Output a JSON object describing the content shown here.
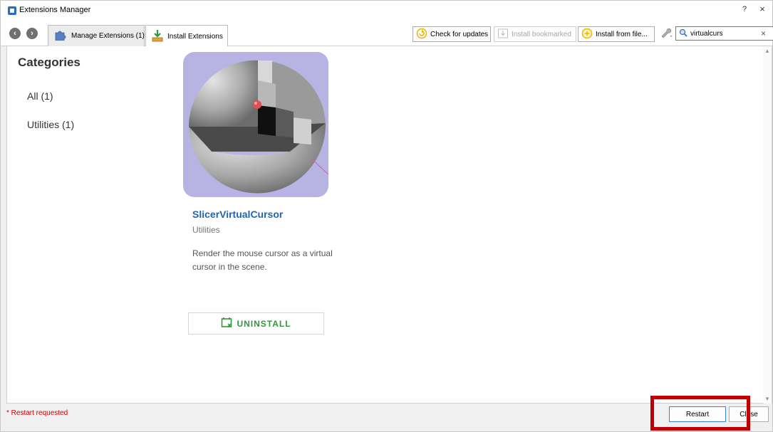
{
  "window": {
    "title": "Extensions Manager",
    "help": "?",
    "close": "×"
  },
  "toolbar": {
    "back_icon": "arrow-left-icon",
    "forward_icon": "arrow-right-icon",
    "tabs": [
      {
        "label": "Manage Extensions (1)",
        "icon": "puzzle-icon",
        "active": false
      },
      {
        "label": "Install Extensions",
        "icon": "install-icon",
        "active": true
      }
    ],
    "check_updates_label": "Check for updates",
    "install_bookmarked_label": "Install bookmarked",
    "install_from_file_label": "Install from file...",
    "search": {
      "value": "virtualcurs",
      "clear": "×"
    }
  },
  "sidebar": {
    "title": "Categories",
    "items": [
      {
        "label": "All (1)"
      },
      {
        "label": "Utilities (1)"
      }
    ]
  },
  "extension": {
    "name": "SlicerVirtualCursor",
    "category": "Utilities",
    "description": "Render the mouse cursor as a virtual cursor in the scene.",
    "uninstall_label": "UNINSTALL"
  },
  "status": {
    "text": "* Restart requested",
    "restart_label": "Restart",
    "close_label": "Close"
  },
  "colors": {
    "accent_blue": "#1e64b4",
    "uninstall_green": "#2e9a3a",
    "status_red": "#cc0000",
    "highlight_red": "#c00000",
    "thumbnail_bg": "#b7b3e3"
  }
}
